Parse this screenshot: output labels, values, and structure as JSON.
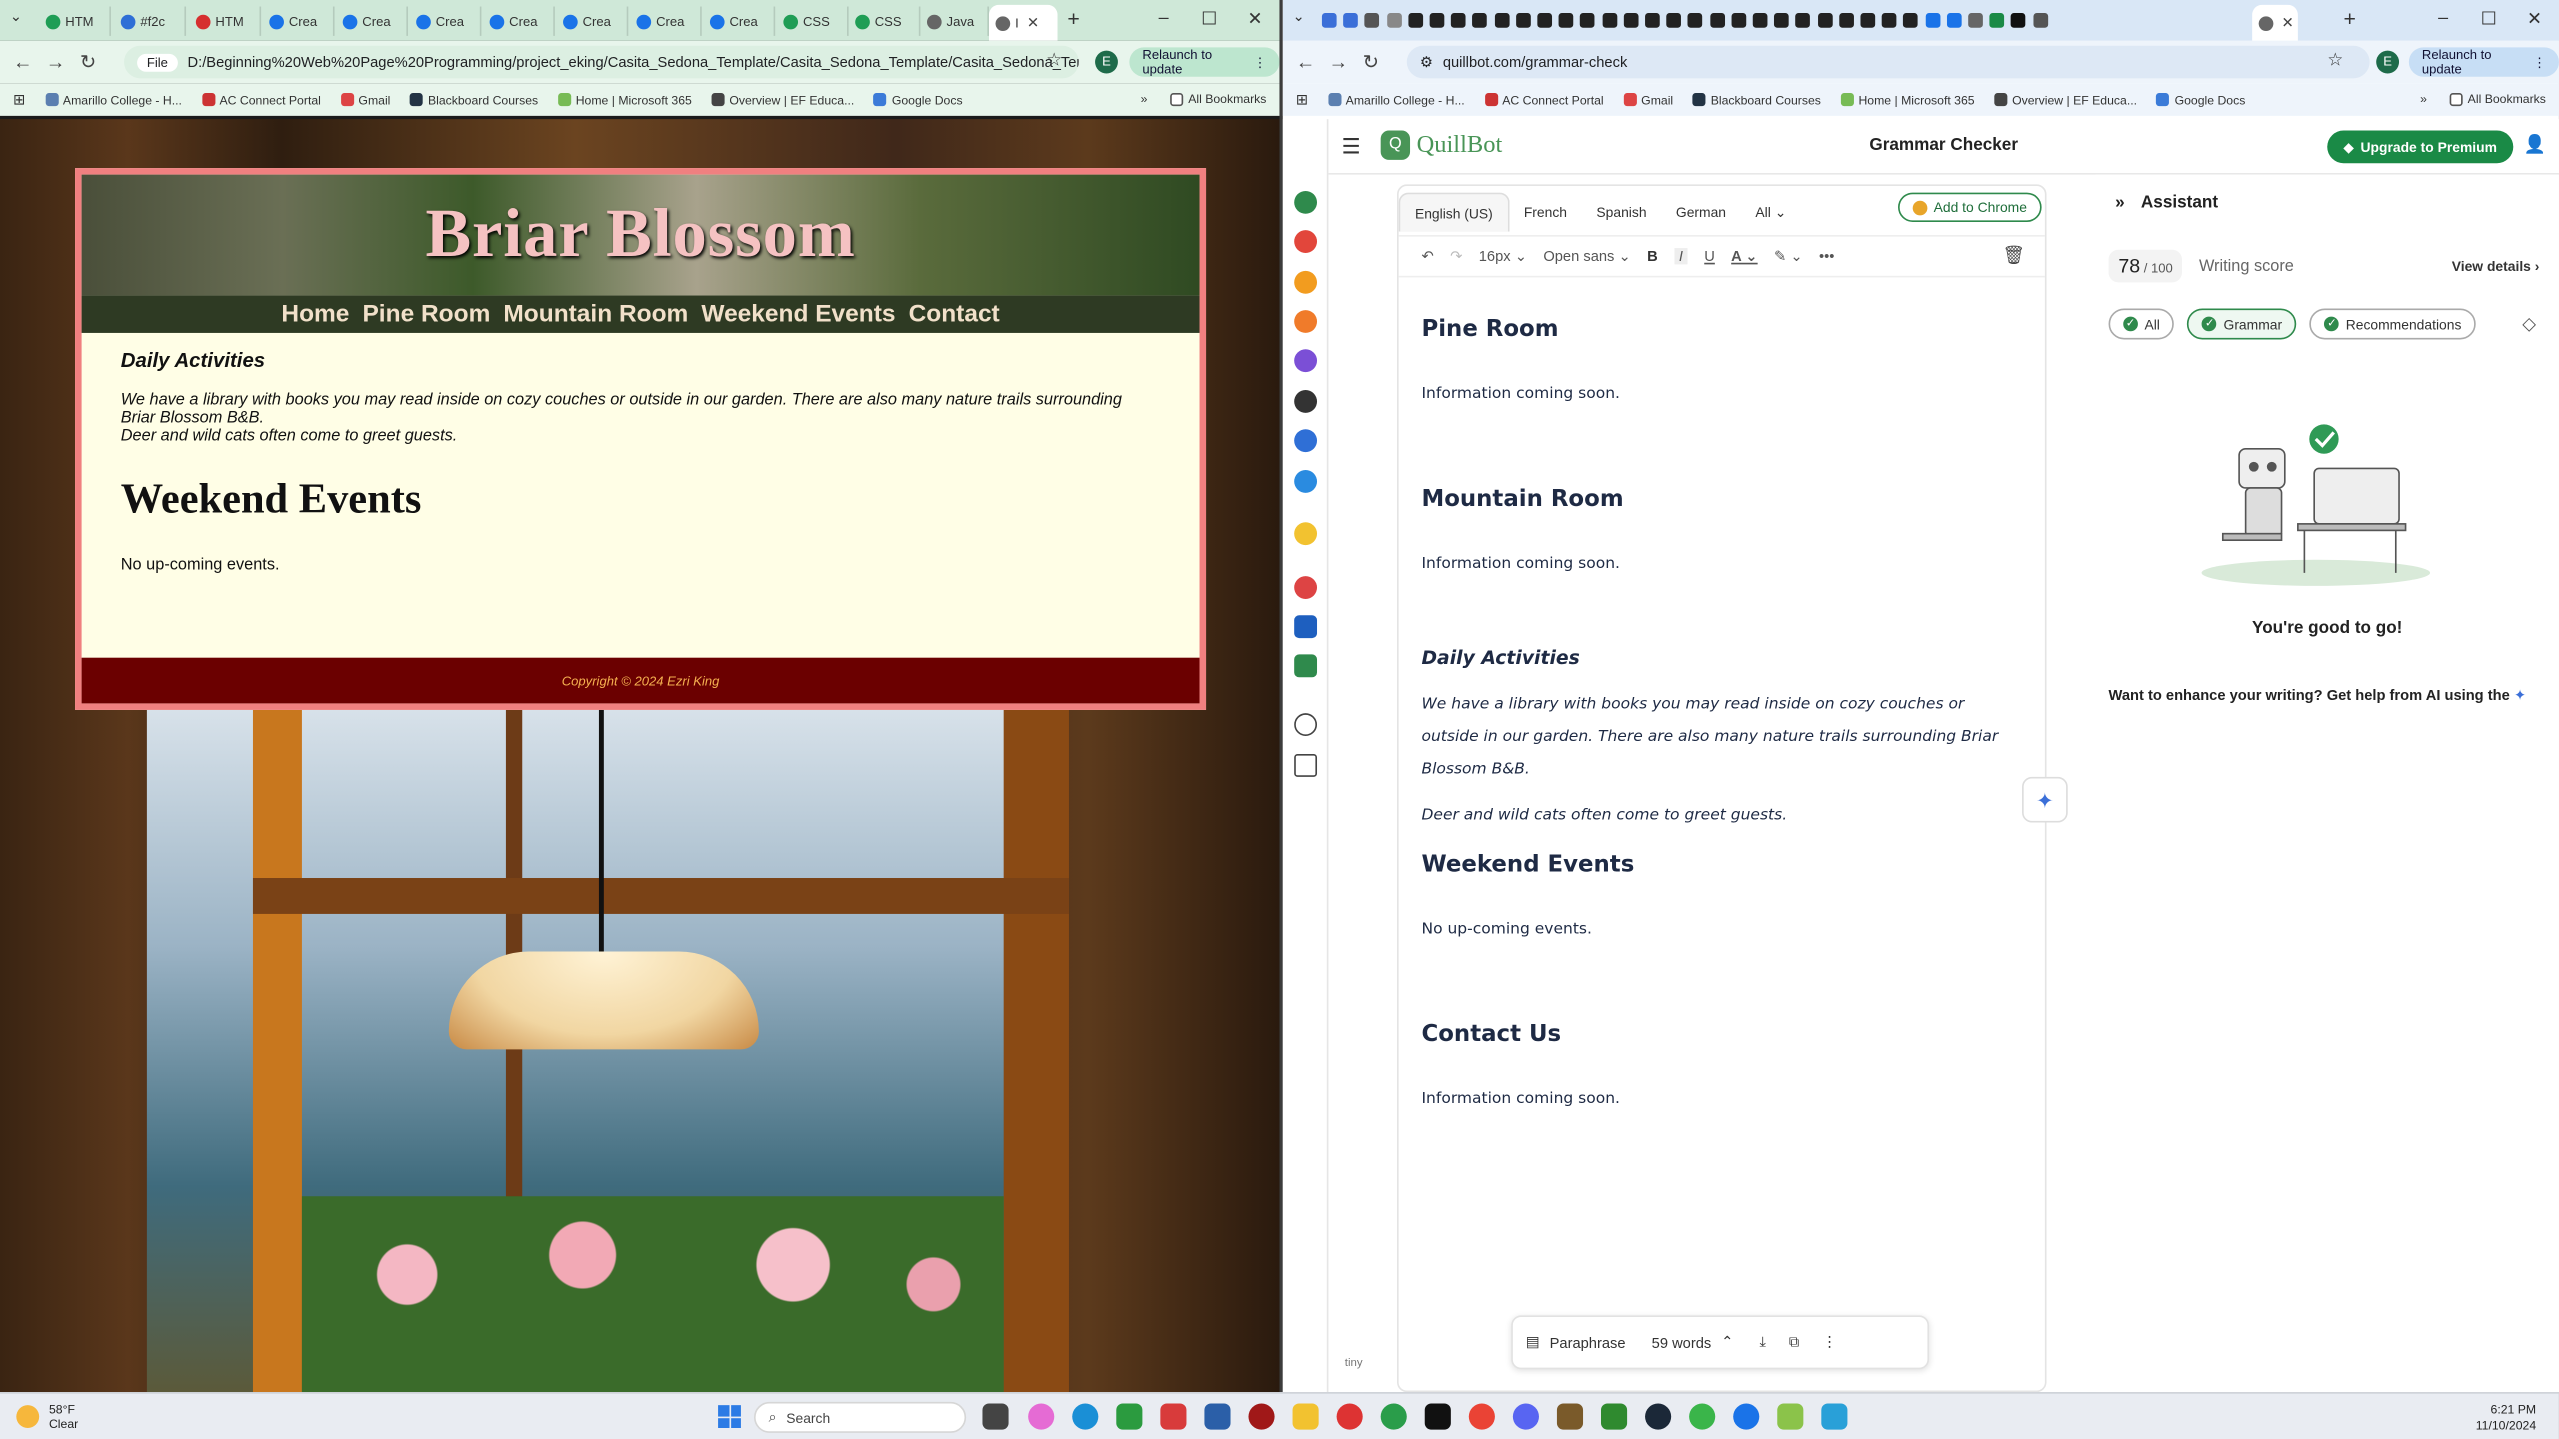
{
  "left_browser": {
    "tabs": [
      "HTM",
      "#f2c",
      "HTM",
      "Crea",
      "Crea",
      "Crea",
      "Crea",
      "Crea",
      "Crea",
      "Crea",
      "CSS",
      "CSS",
      "Java",
      "I"
    ],
    "address": "D:/Beginning%20Web%20Page%20Programming/project_eking/Casita_Sedona_Template/Casita_Sedona_Template/Casita_Sedona_Temp...",
    "file_chip": "File",
    "profile": "E",
    "relaunch": "Relaunch to update",
    "bookmarks": [
      "Amarillo College - H...",
      "AC Connect Portal",
      "Gmail",
      "Blackboard Courses",
      "Home | Microsoft 365",
      "Overview | EF Educa...",
      "Google Docs"
    ],
    "all_bookmarks": "All Bookmarks"
  },
  "site": {
    "title": "Briar Blossom",
    "nav": [
      "Home",
      "Pine Room",
      "Mountain Room",
      "Weekend Events",
      "Contact"
    ],
    "daily_heading": "Daily Activities",
    "daily_text_1": "We have a library with books you may read inside on cozy couches or outside in our garden. There are also many nature trails surrounding Briar Blossom B&B.",
    "daily_text_2": "Deer and wild cats often come to greet guests.",
    "events_heading": "Weekend Events",
    "events_text": "No up-coming events.",
    "footer": "Copyright © 2024 Ezri King"
  },
  "right_browser": {
    "address": "quillbot.com/grammar-check",
    "profile": "E",
    "relaunch": "Relaunch to update",
    "bookmarks": [
      "Amarillo College - H...",
      "AC Connect Portal",
      "Gmail",
      "Blackboard Courses",
      "Home | Microsoft 365",
      "Overview | EF Educa...",
      "Google Docs"
    ],
    "all_bookmarks": "All Bookmarks"
  },
  "quillbot": {
    "logo": "QuillBot",
    "page_title": "Grammar Checker",
    "premium": "Upgrade to Premium",
    "languages": [
      "English (US)",
      "French",
      "Spanish",
      "German",
      "All"
    ],
    "add_to_chrome": "Add to Chrome",
    "font_size": "16px",
    "font_family": "Open sans",
    "doc": {
      "h_pine": "Pine Room",
      "p_pine": "Information coming soon.",
      "h_mountain": "Mountain Room",
      "p_mountain": "Information coming soon.",
      "h_daily": "Daily Activities",
      "p_daily_1": "We have a library with books you may read inside on cozy couches or outside in our garden. There are also many nature trails surrounding Briar Blossom B&B.",
      "p_daily_2": "Deer and wild cats often come to greet guests.",
      "h_weekend": "Weekend Events",
      "p_weekend": "No up-coming events.",
      "h_contact": "Contact Us",
      "p_contact": "Information coming soon."
    },
    "bottom": {
      "paraphrase": "Paraphrase",
      "words": "59 words"
    },
    "tiny": "tiny",
    "assistant": {
      "title": "Assistant",
      "score": "78",
      "score_max": "100",
      "score_label": "Writing score",
      "view_details": "View details",
      "filters": [
        "All",
        "Grammar",
        "Recommendations"
      ],
      "good": "You're good to go!",
      "enhance": "Want to enhance your writing? Get help from AI using the"
    }
  },
  "taskbar": {
    "temp": "58°F",
    "condition": "Clear",
    "search": "Search",
    "time": "6:21 PM",
    "date": "11/10/2024"
  }
}
